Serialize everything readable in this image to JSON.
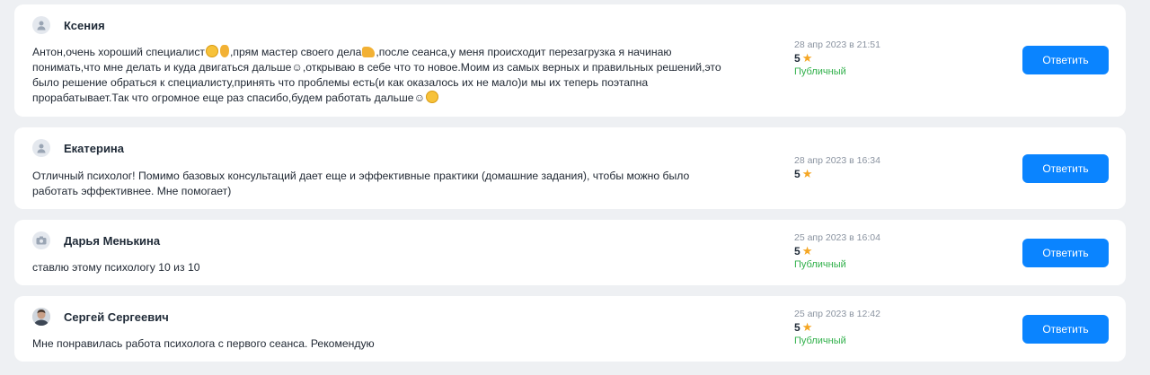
{
  "reply_label": "Ответить",
  "reviews": [
    {
      "author": "Ксения",
      "avatar": "user-placeholder-icon",
      "text_parts": [
        "Антон,очень хороший специалист",
        ",прям мастер своего дела",
        ",после сеанса,у меня происходит перезагрузка я начинаю понимать,что мне делать и куда двигаться дальше☺,открываю в себе что то новое.Моим из самых верных и правильных решений,это было решение обраться к специалисту,принять что проблемы есть(и как оказалось их не мало)и мы их теперь поэтапна прорабатывает.Так что огромное еще раз спасибо,будем работать дальше☺"
      ],
      "date": "28 апр 2023 в 21:51",
      "rating": "5",
      "status": "Публичный"
    },
    {
      "author": "Екатерина",
      "avatar": "user-placeholder-icon",
      "text": "Отличный психолог! Помимо базовых консультаций дает еще и эффективные практики (домашние задания), чтобы можно было работать эффективнее. Мне помогает)",
      "date": "28 апр 2023 в 16:34",
      "rating": "5",
      "status": ""
    },
    {
      "author": "Дарья Менькина",
      "avatar": "camera-placeholder-icon",
      "text": "ставлю этому психологу 10 из 10",
      "date": "25 апр 2023 в 16:04",
      "rating": "5",
      "status": "Публичный"
    },
    {
      "author": "Сергей Сергеевич",
      "avatar": "user-photo",
      "text": "Мне понравилась работа психолога с первого сеанса. Рекомендую",
      "date": "25 апр 2023 в 12:42",
      "rating": "5",
      "status": "Публичный"
    }
  ],
  "colors": {
    "accent": "#0a84ff",
    "status_public": "#30b04a",
    "star": "#f5a623",
    "background": "#eef0f3"
  }
}
